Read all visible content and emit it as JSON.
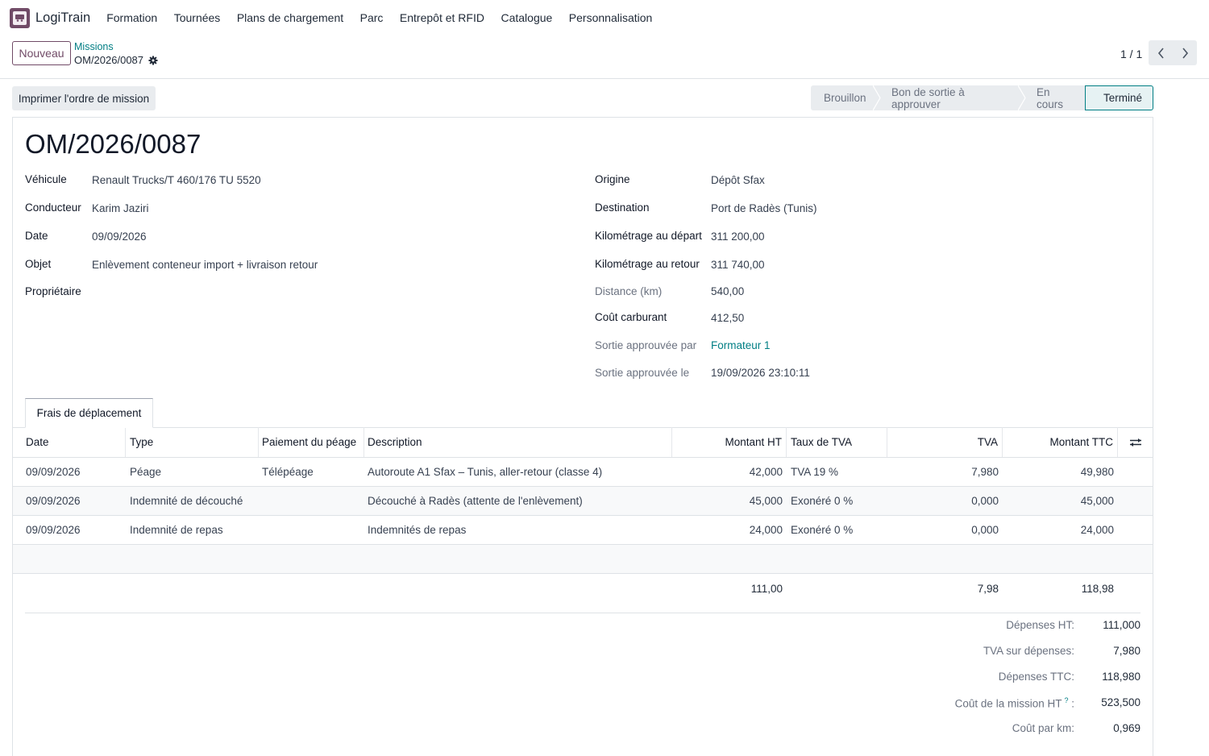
{
  "nav": {
    "app_name": "LogiTrain",
    "menu": [
      "Formation",
      "Tournées",
      "Plans de chargement",
      "Parc",
      "Entrepôt et RFID",
      "Catalogue",
      "Personnalisation"
    ]
  },
  "control": {
    "new_label": "Nouveau",
    "breadcrumb_parent": "Missions",
    "breadcrumb_current": "OM/2026/0087",
    "pager": "1 / 1"
  },
  "actions": {
    "print_label": "Imprimer l'ordre de mission"
  },
  "status": {
    "stages": [
      "Brouillon",
      "Bon de sortie à approuver",
      "En cours",
      "Terminé"
    ],
    "active": "Terminé"
  },
  "form": {
    "title": "OM/2026/0087",
    "left": [
      {
        "label": "Véhicule",
        "value": "Renault Trucks/T 460/176 TU 5520"
      },
      {
        "label": "Conducteur",
        "value": "Karim Jaziri"
      },
      {
        "label": "Date",
        "value": "09/09/2026"
      },
      {
        "label": "Objet",
        "value": "Enlèvement conteneur import + livraison retour"
      },
      {
        "label": "Propriétaire",
        "value": ""
      }
    ],
    "right": [
      {
        "label": "Origine",
        "value": "Dépôt Sfax"
      },
      {
        "label": "Destination",
        "value": "Port de Radès (Tunis)"
      },
      {
        "label": "Kilométrage au départ",
        "value": "311 200,00"
      },
      {
        "label": "Kilométrage au retour",
        "value": "311 740,00"
      },
      {
        "label": "Distance (km)",
        "value": "540,00"
      },
      {
        "label": "Coût carburant",
        "value": "412,50"
      },
      {
        "label": "Sortie approuvée par",
        "value": "Formateur 1"
      },
      {
        "label": "Sortie approuvée le",
        "value": "19/09/2026 23:10:11"
      }
    ]
  },
  "notebook": {
    "tab_label": "Frais de déplacement"
  },
  "table": {
    "columns": [
      "Date",
      "Type",
      "Paiement du péage",
      "Description",
      "Montant HT",
      "Taux de TVA",
      "TVA",
      "Montant TTC"
    ],
    "rows": [
      [
        "09/09/2026",
        "Péage",
        "Télépéage",
        "Autoroute A1 Sfax – Tunis, aller-retour (classe 4)",
        "42,000",
        "TVA 19 %",
        "7,980",
        "49,980"
      ],
      [
        "09/09/2026",
        "Indemnité de découché",
        "",
        "Découché à Radès (attente de l'enlèvement)",
        "45,000",
        "Exonéré 0 %",
        "0,000",
        "45,000"
      ],
      [
        "09/09/2026",
        "Indemnité de repas",
        "",
        "Indemnités de repas",
        "24,000",
        "Exonéré 0 %",
        "0,000",
        "24,000"
      ]
    ],
    "totals": {
      "ht": "111,00",
      "tva": "7,98",
      "ttc": "118,98"
    }
  },
  "summary": [
    {
      "label": "Dépenses HT:",
      "value": "111,000"
    },
    {
      "label": "TVA sur dépenses:",
      "value": "7,980"
    },
    {
      "label": "Dépenses TTC:",
      "value": "118,980"
    },
    {
      "label": "Coût de la mission HT",
      "suffix": " :",
      "help": "?",
      "value": "523,500"
    },
    {
      "label": "Coût par km:",
      "value": "0,969"
    }
  ],
  "colors": {
    "brand": "#714b67",
    "link": "#017e84",
    "border": "#dee2e6"
  }
}
